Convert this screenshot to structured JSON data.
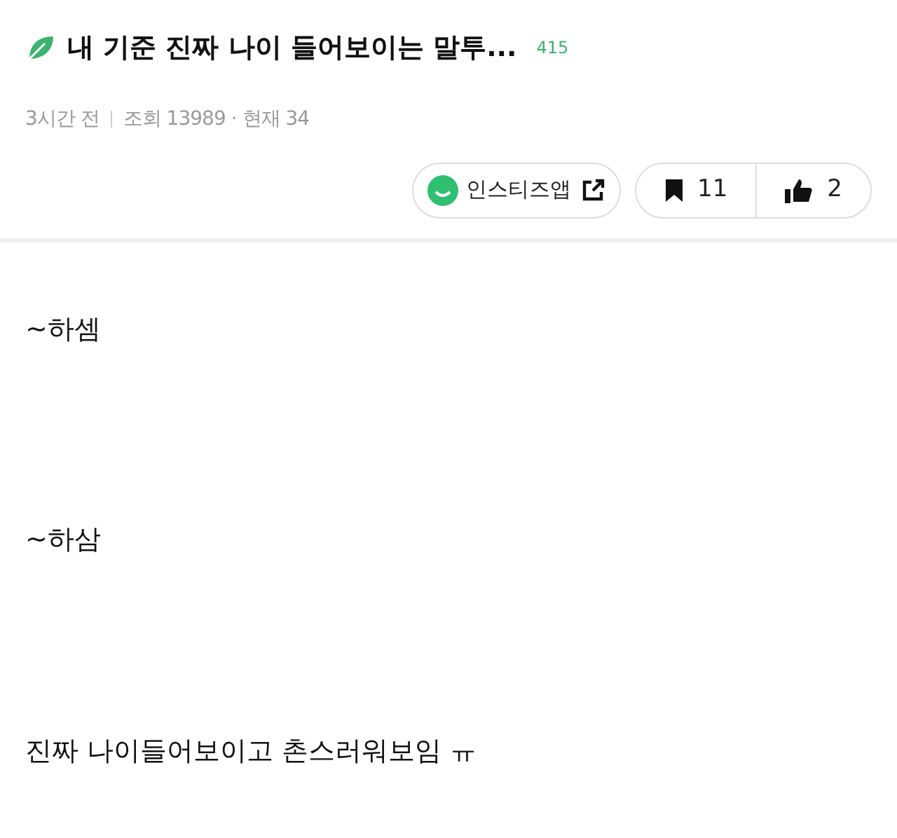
{
  "post": {
    "title": "내 기준 진짜 나이 들어보이는 말투...",
    "comment_count": "415",
    "time": "3시간 전",
    "views": "조회 13989",
    "current": "· 현재 34"
  },
  "actions": {
    "app_link": "인스티즈앱",
    "bookmarks": "11",
    "likes": "2"
  },
  "body": [
    "~하셈",
    "~하삼",
    "진짜 나이들어보이고 촌스러워보임 ㅠ"
  ]
}
